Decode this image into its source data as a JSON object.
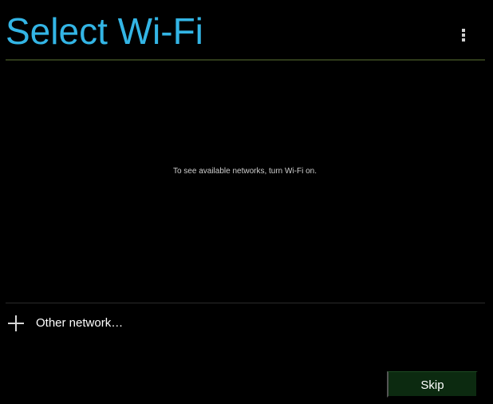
{
  "header": {
    "title": "Select Wi-Fi",
    "overflow_icon": "overflow-menu-icon"
  },
  "main": {
    "empty_message": "To see available networks, turn Wi-Fi on."
  },
  "other_network": {
    "icon": "plus-icon",
    "label": "Other network…"
  },
  "footer": {
    "skip_label": "Skip"
  },
  "colors": {
    "accent": "#33b5e5",
    "background": "#000000",
    "button_background": "#0c2a10"
  }
}
